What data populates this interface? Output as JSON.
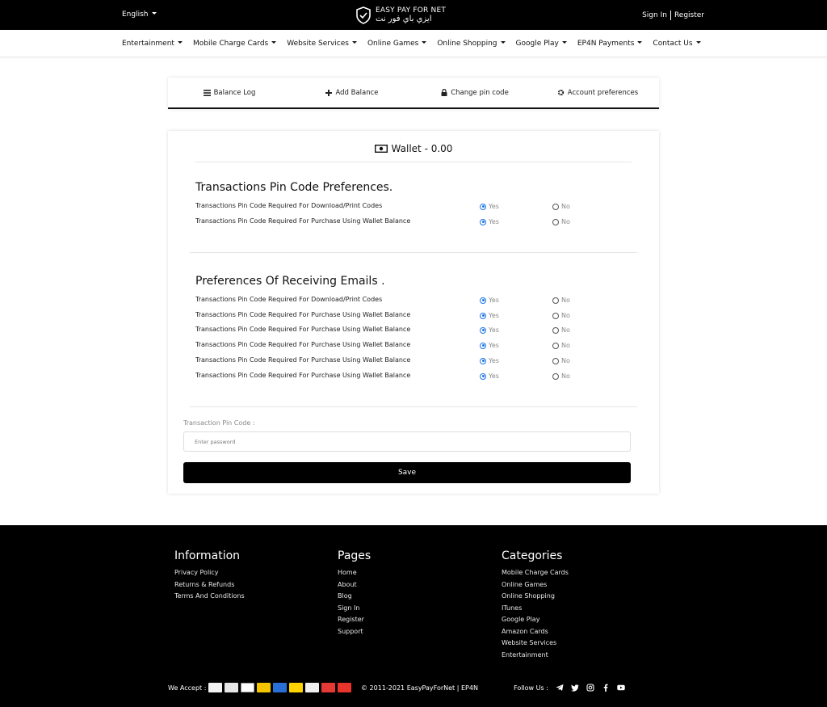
{
  "header": {
    "language": "English",
    "logo_en": "EASY PAY FOR NET",
    "logo_ar": "ايزي باي فور نت",
    "sign_in": "Sign In",
    "register": "Register"
  },
  "nav": {
    "items": [
      {
        "label": "Entertainment"
      },
      {
        "label": "Mobile Charge Cards"
      },
      {
        "label": "Website Services"
      },
      {
        "label": "Online Games"
      },
      {
        "label": "Online Shopping"
      },
      {
        "label": "Google Play"
      },
      {
        "label": "EP4N Payments"
      },
      {
        "label": "Contact Us"
      }
    ]
  },
  "tabs": [
    {
      "label": "Balance Log",
      "icon": "list-icon"
    },
    {
      "label": "Add Balance",
      "icon": "plus-icon"
    },
    {
      "label": "Change pin code",
      "icon": "lock-icon"
    },
    {
      "label": "Account preferences",
      "icon": "gear-icon"
    }
  ],
  "wallet": {
    "label": "Wallet - 0.00",
    "icon": "money-icon"
  },
  "pin_section": {
    "title": "Transactions Pin Code Preferences.",
    "rows": [
      {
        "label": "Transactions Pin Code Required For Download/Print Codes",
        "yes": "Yes",
        "no": "No",
        "selected": "yes"
      },
      {
        "label": "Transactions Pin Code Required For Purchase Using Wallet Balance",
        "yes": "Yes",
        "no": "No",
        "selected": "yes"
      }
    ]
  },
  "email_section": {
    "title": "Preferences Of Receiving Emails .",
    "rows": [
      {
        "label": "Transactions Pin Code Required For Download/Print Codes",
        "yes": "Yes",
        "no": "No",
        "selected": "yes"
      },
      {
        "label": "Transactions Pin Code Required For Purchase Using Wallet Balance",
        "yes": "Yes",
        "no": "No",
        "selected": "yes"
      },
      {
        "label": "Transactions Pin Code Required For Purchase Using Wallet Balance",
        "yes": "Yes",
        "no": "No",
        "selected": "yes"
      },
      {
        "label": "Transactions Pin Code Required For Purchase Using Wallet Balance",
        "yes": "Yes",
        "no": "No",
        "selected": "yes"
      },
      {
        "label": "Transactions Pin Code Required For Purchase Using Wallet Balance",
        "yes": "Yes",
        "no": "No",
        "selected": "yes"
      },
      {
        "label": "Transactions Pin Code Required For Purchase Using Wallet Balance",
        "yes": "Yes",
        "no": "No",
        "selected": "yes"
      }
    ]
  },
  "pin_form": {
    "label": "Transaction Pin Code :",
    "placeholder": "Enter password",
    "value": "",
    "save": "Save"
  },
  "footer": {
    "information": {
      "title": "Information",
      "links": [
        "Privacy Policy",
        "Returns & Refunds",
        "Terms And Conditions"
      ]
    },
    "pages": {
      "title": "Pages",
      "links": [
        "Home",
        "About",
        "Blog",
        "Sign In",
        "Register",
        "Support"
      ]
    },
    "categories": {
      "title": "Categories",
      "links": [
        "Mobile Charge Cards",
        "Online Games",
        "Online Shopping",
        "ITunes",
        "Google Play",
        "Amazon Cards",
        "Website Services",
        "Entertainment"
      ]
    },
    "we_accept": "We Accept :",
    "copyright": "© 2011-2021 EasyPayForNet | EP4N",
    "follow_us": "Follow Us :",
    "social_icons": [
      "telegram-icon",
      "twitter-icon",
      "instagram-icon",
      "facebook-icon",
      "youtube-icon"
    ]
  },
  "colors": {
    "radio_selected": "#1a73e8",
    "dark": "#000000"
  }
}
